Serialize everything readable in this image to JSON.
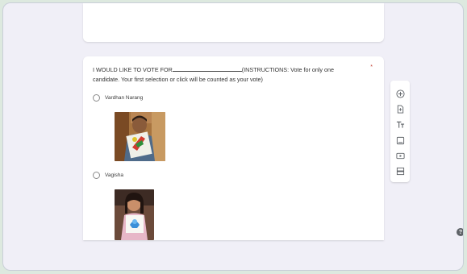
{
  "question": {
    "prefix": "I WOULD LIKE TO VOTE FOR",
    "suffix": "(INSTRUCTIONS: Vote for only one candidate. Your first selection or click will be counted as your vote)",
    "required_mark": "*"
  },
  "options": [
    {
      "label": "Vardhan Narang",
      "image": "candidate-photo-boy"
    },
    {
      "label": "Vagisha",
      "image": "candidate-photo-girl"
    }
  ],
  "toolbar": {
    "items": [
      {
        "icon": "add-question-icon"
      },
      {
        "icon": "import-questions-icon"
      },
      {
        "icon": "add-title-icon"
      },
      {
        "icon": "add-image-icon"
      },
      {
        "icon": "add-video-icon"
      },
      {
        "icon": "add-section-icon"
      }
    ]
  },
  "help": {
    "label": "?"
  },
  "colors": {
    "outer_bg": "#dde9df",
    "canvas_bg": "#f0eff7",
    "card_bg": "#ffffff",
    "icon": "#5f6368"
  }
}
